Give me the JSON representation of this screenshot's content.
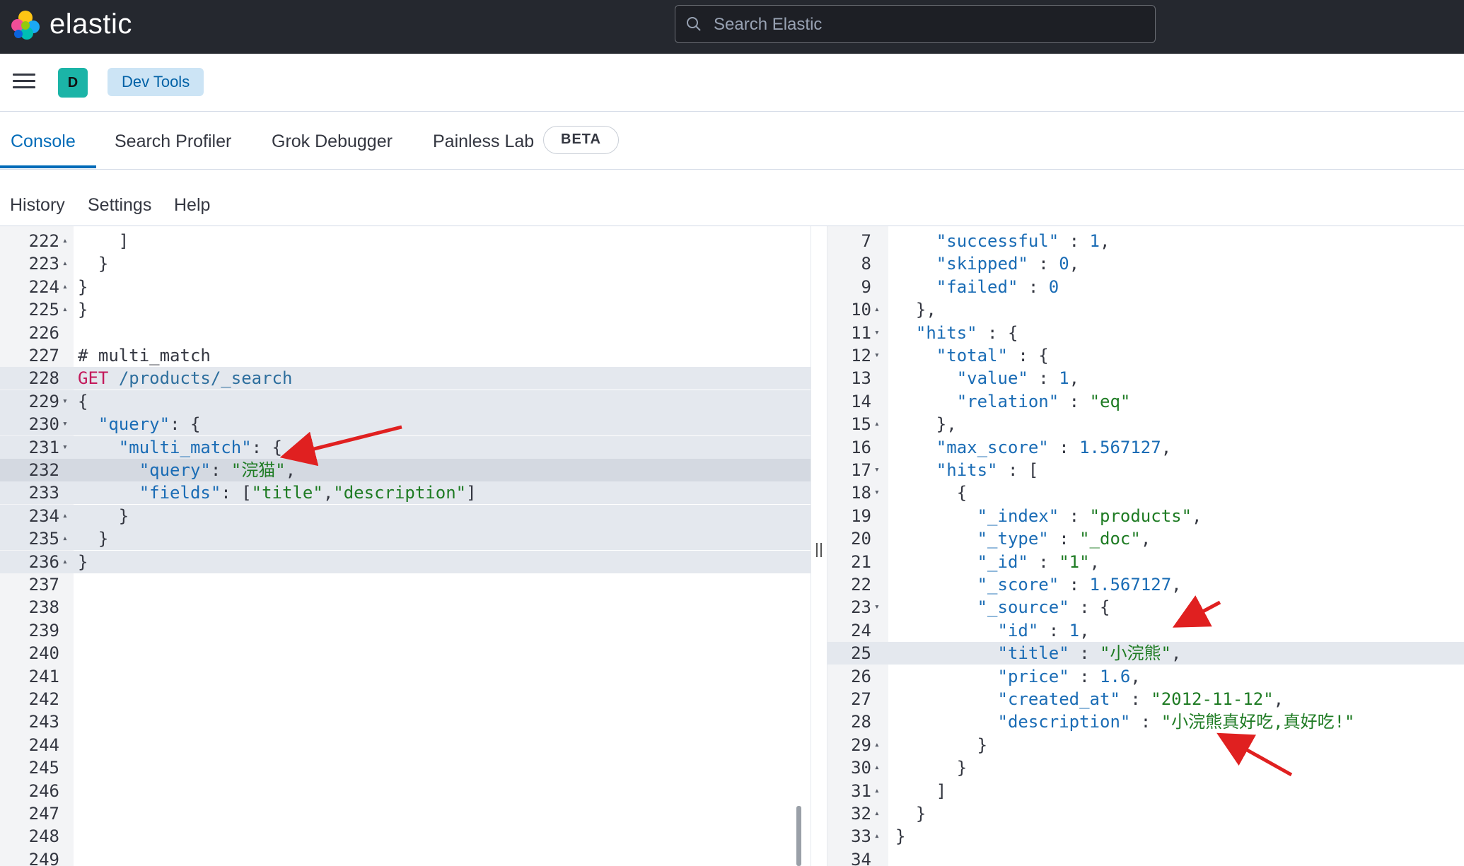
{
  "brand": {
    "name": "elastic"
  },
  "search": {
    "placeholder": "Search Elastic"
  },
  "header": {
    "avatar_letter": "D",
    "breadcrumb": "Dev Tools"
  },
  "tabs": [
    {
      "label": "Console",
      "active": true
    },
    {
      "label": "Search Profiler"
    },
    {
      "label": "Grok Debugger"
    },
    {
      "label": "Painless Lab"
    }
  ],
  "beta_badge": "BETA",
  "toolbar": {
    "history": "History",
    "settings": "Settings",
    "help": "Help"
  },
  "editor": {
    "lines": [
      {
        "n": "222",
        "fold": "▴",
        "text": "    ]"
      },
      {
        "n": "223",
        "fold": "▴",
        "text": "  }"
      },
      {
        "n": "224",
        "fold": "▴",
        "text": "}"
      },
      {
        "n": "225",
        "fold": "▴",
        "text": "}"
      },
      {
        "n": "226",
        "fold": "",
        "text": ""
      },
      {
        "n": "227",
        "fold": "",
        "text": "# multi_match"
      },
      {
        "n": "228",
        "fold": "",
        "text": "GET /products/_search"
      },
      {
        "n": "229",
        "fold": "▾",
        "text": "{"
      },
      {
        "n": "230",
        "fold": "▾",
        "text": "  \"query\": {"
      },
      {
        "n": "231",
        "fold": "▾",
        "text": "    \"multi_match\": {"
      },
      {
        "n": "232",
        "fold": "",
        "text": "      \"query\": \"浣猫\","
      },
      {
        "n": "233",
        "fold": "",
        "text": "      \"fields\": [\"title\",\"description\"]"
      },
      {
        "n": "234",
        "fold": "▴",
        "text": "    }"
      },
      {
        "n": "235",
        "fold": "▴",
        "text": "  }"
      },
      {
        "n": "236",
        "fold": "▴",
        "text": "}"
      },
      {
        "n": "237",
        "fold": "",
        "text": ""
      },
      {
        "n": "238",
        "fold": "",
        "text": ""
      },
      {
        "n": "239",
        "fold": "",
        "text": ""
      },
      {
        "n": "240",
        "fold": "",
        "text": ""
      },
      {
        "n": "241",
        "fold": "",
        "text": ""
      },
      {
        "n": "242",
        "fold": "",
        "text": ""
      },
      {
        "n": "243",
        "fold": "",
        "text": ""
      },
      {
        "n": "244",
        "fold": "",
        "text": ""
      },
      {
        "n": "245",
        "fold": "",
        "text": ""
      },
      {
        "n": "246",
        "fold": "",
        "text": ""
      },
      {
        "n": "247",
        "fold": "",
        "text": ""
      },
      {
        "n": "248",
        "fold": "",
        "text": ""
      },
      {
        "n": "249",
        "fold": "",
        "text": ""
      }
    ]
  },
  "output": {
    "lines": [
      {
        "n": "7",
        "fold": "",
        "text": "    \"successful\" : 1,"
      },
      {
        "n": "8",
        "fold": "",
        "text": "    \"skipped\" : 0,"
      },
      {
        "n": "9",
        "fold": "",
        "text": "    \"failed\" : 0"
      },
      {
        "n": "10",
        "fold": "▴",
        "text": "  },"
      },
      {
        "n": "11",
        "fold": "▾",
        "text": "  \"hits\" : {"
      },
      {
        "n": "12",
        "fold": "▾",
        "text": "    \"total\" : {"
      },
      {
        "n": "13",
        "fold": "",
        "text": "      \"value\" : 1,"
      },
      {
        "n": "14",
        "fold": "",
        "text": "      \"relation\" : \"eq\""
      },
      {
        "n": "15",
        "fold": "▴",
        "text": "    },"
      },
      {
        "n": "16",
        "fold": "",
        "text": "    \"max_score\" : 1.567127,"
      },
      {
        "n": "17",
        "fold": "▾",
        "text": "    \"hits\" : ["
      },
      {
        "n": "18",
        "fold": "▾",
        "text": "      {"
      },
      {
        "n": "19",
        "fold": "",
        "text": "        \"_index\" : \"products\","
      },
      {
        "n": "20",
        "fold": "",
        "text": "        \"_type\" : \"_doc\","
      },
      {
        "n": "21",
        "fold": "",
        "text": "        \"_id\" : \"1\","
      },
      {
        "n": "22",
        "fold": "",
        "text": "        \"_score\" : 1.567127,"
      },
      {
        "n": "23",
        "fold": "▾",
        "text": "        \"_source\" : {"
      },
      {
        "n": "24",
        "fold": "",
        "text": "          \"id\" : 1,"
      },
      {
        "n": "25",
        "fold": "",
        "text": "          \"title\" : \"小浣熊\","
      },
      {
        "n": "26",
        "fold": "",
        "text": "          \"price\" : 1.6,"
      },
      {
        "n": "27",
        "fold": "",
        "text": "          \"created_at\" : \"2012-11-12\","
      },
      {
        "n": "28",
        "fold": "",
        "text": "          \"description\" : \"小浣熊真好吃,真好吃!\""
      },
      {
        "n": "29",
        "fold": "▴",
        "text": "        }"
      },
      {
        "n": "30",
        "fold": "▴",
        "text": "      }"
      },
      {
        "n": "31",
        "fold": "▴",
        "text": "    ]"
      },
      {
        "n": "32",
        "fold": "▴",
        "text": "  }"
      },
      {
        "n": "33",
        "fold": "▴",
        "text": "}"
      },
      {
        "n": "34",
        "fold": "",
        "text": ""
      }
    ]
  },
  "colors": {
    "topbar": "#25282f",
    "accent": "#006bb8",
    "avatar": "#1bb4a7",
    "breadcrumb_bg": "#cce4f5",
    "string": "#1e7b23",
    "key": "#1a6cb5",
    "method": "#c3185a",
    "annotation_arrow": "#e02020"
  },
  "icons": [
    "elastic-logo-icon",
    "search-icon",
    "hamburger-menu-icon",
    "play-request-icon",
    "wrench-icon"
  ]
}
